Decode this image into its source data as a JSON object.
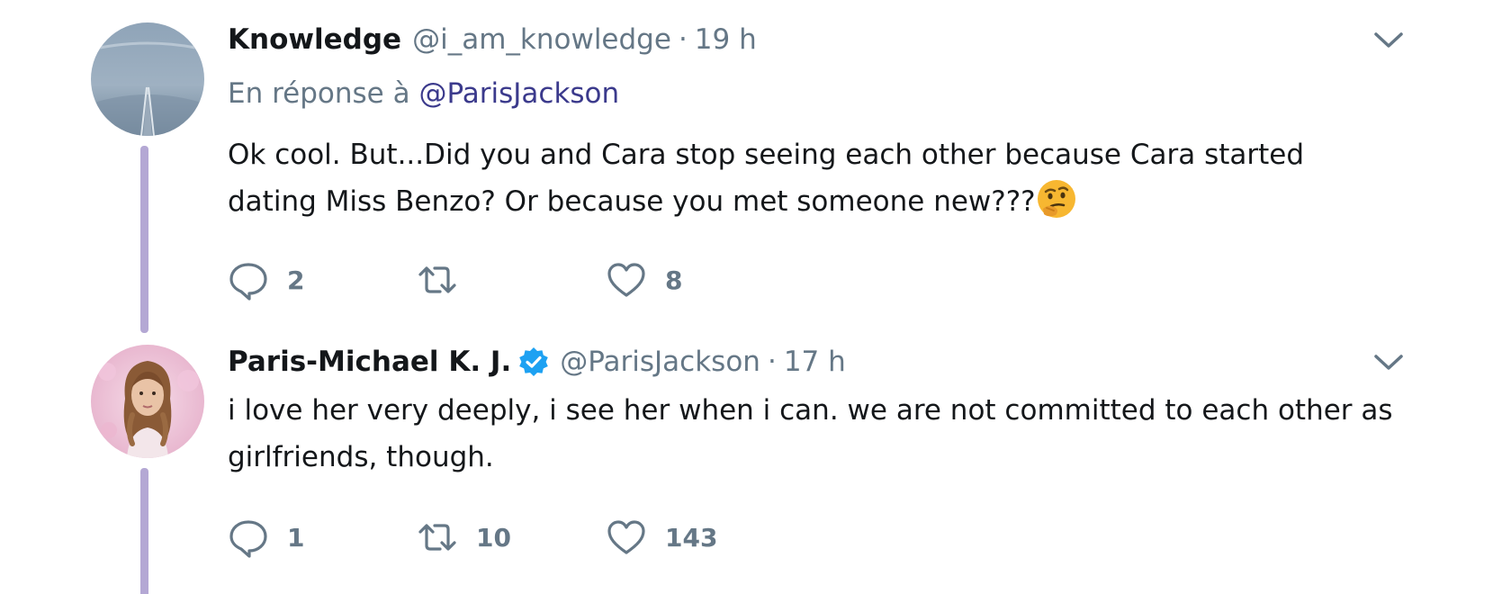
{
  "tweets": [
    {
      "display_name": "Knowledge",
      "handle": "@i_am_knowledge",
      "separator": "·",
      "time": "19 h",
      "verified": false,
      "reply_context": {
        "prefix": "En réponse à",
        "mention": "@ParisJackson"
      },
      "text": "Ok cool. But...Did you and Cara stop seeing each other because Cara started dating Miss Benzo? Or because you met someone new???",
      "emoji": "thinking-face",
      "actions": {
        "replies": "2",
        "retweets": "",
        "likes": "8"
      }
    },
    {
      "display_name": "Paris-Michael K. J.",
      "handle": "@ParisJackson",
      "separator": "·",
      "time": "17 h",
      "verified": true,
      "text": "i love her very deeply, i see her when i can. we are not committed to each other as girlfriends, though.",
      "actions": {
        "replies": "1",
        "retweets": "10",
        "likes": "143"
      }
    }
  ],
  "colors": {
    "text": "#14171a",
    "secondary": "#657786",
    "mention": "#3b3a8c",
    "thread_line": "#b4a8d4",
    "verified": "#1da1f2"
  },
  "icons": {
    "reply": "reply-icon",
    "retweet": "retweet-icon",
    "like": "heart-icon",
    "menu": "chevron-down-icon",
    "verified": "verified-badge-icon"
  }
}
